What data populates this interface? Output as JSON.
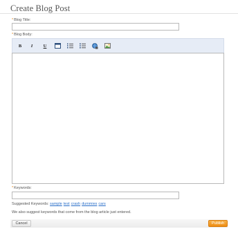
{
  "page": {
    "title": "Create Blog Post"
  },
  "fields": {
    "required_mark": "*",
    "blog_title": {
      "label": "Blog Title:",
      "value": "",
      "placeholder": ""
    },
    "blog_body": {
      "label": "Blog Body:",
      "value": ""
    },
    "keywords": {
      "label": "Keywords:",
      "value": "",
      "placeholder": ""
    }
  },
  "toolbar": {
    "buttons": [
      {
        "name": "bold",
        "glyph": "B"
      },
      {
        "name": "italic",
        "glyph": "I"
      },
      {
        "name": "underline",
        "glyph": "U"
      },
      {
        "name": "table",
        "icon": "table-icon"
      },
      {
        "name": "numbered-list",
        "icon": "numbered-list-icon"
      },
      {
        "name": "bulleted-list",
        "icon": "bulleted-list-icon"
      },
      {
        "name": "link",
        "icon": "globe-link-icon"
      },
      {
        "name": "image",
        "icon": "image-icon"
      }
    ]
  },
  "suggestions": {
    "label": "Suggested Keywords:",
    "keywords": [
      "sample",
      "test",
      "crash",
      "dummies",
      "cars"
    ],
    "note": "We also suggest keywords that come from the blog article just entered."
  },
  "actions": {
    "cancel_label": "Cancel",
    "publish_label": "Publish"
  },
  "colors": {
    "accent": "#ee8d12",
    "link": "#2a6fc9",
    "toolbar_bg": "#e6ecf6",
    "required": "#e8891a"
  }
}
